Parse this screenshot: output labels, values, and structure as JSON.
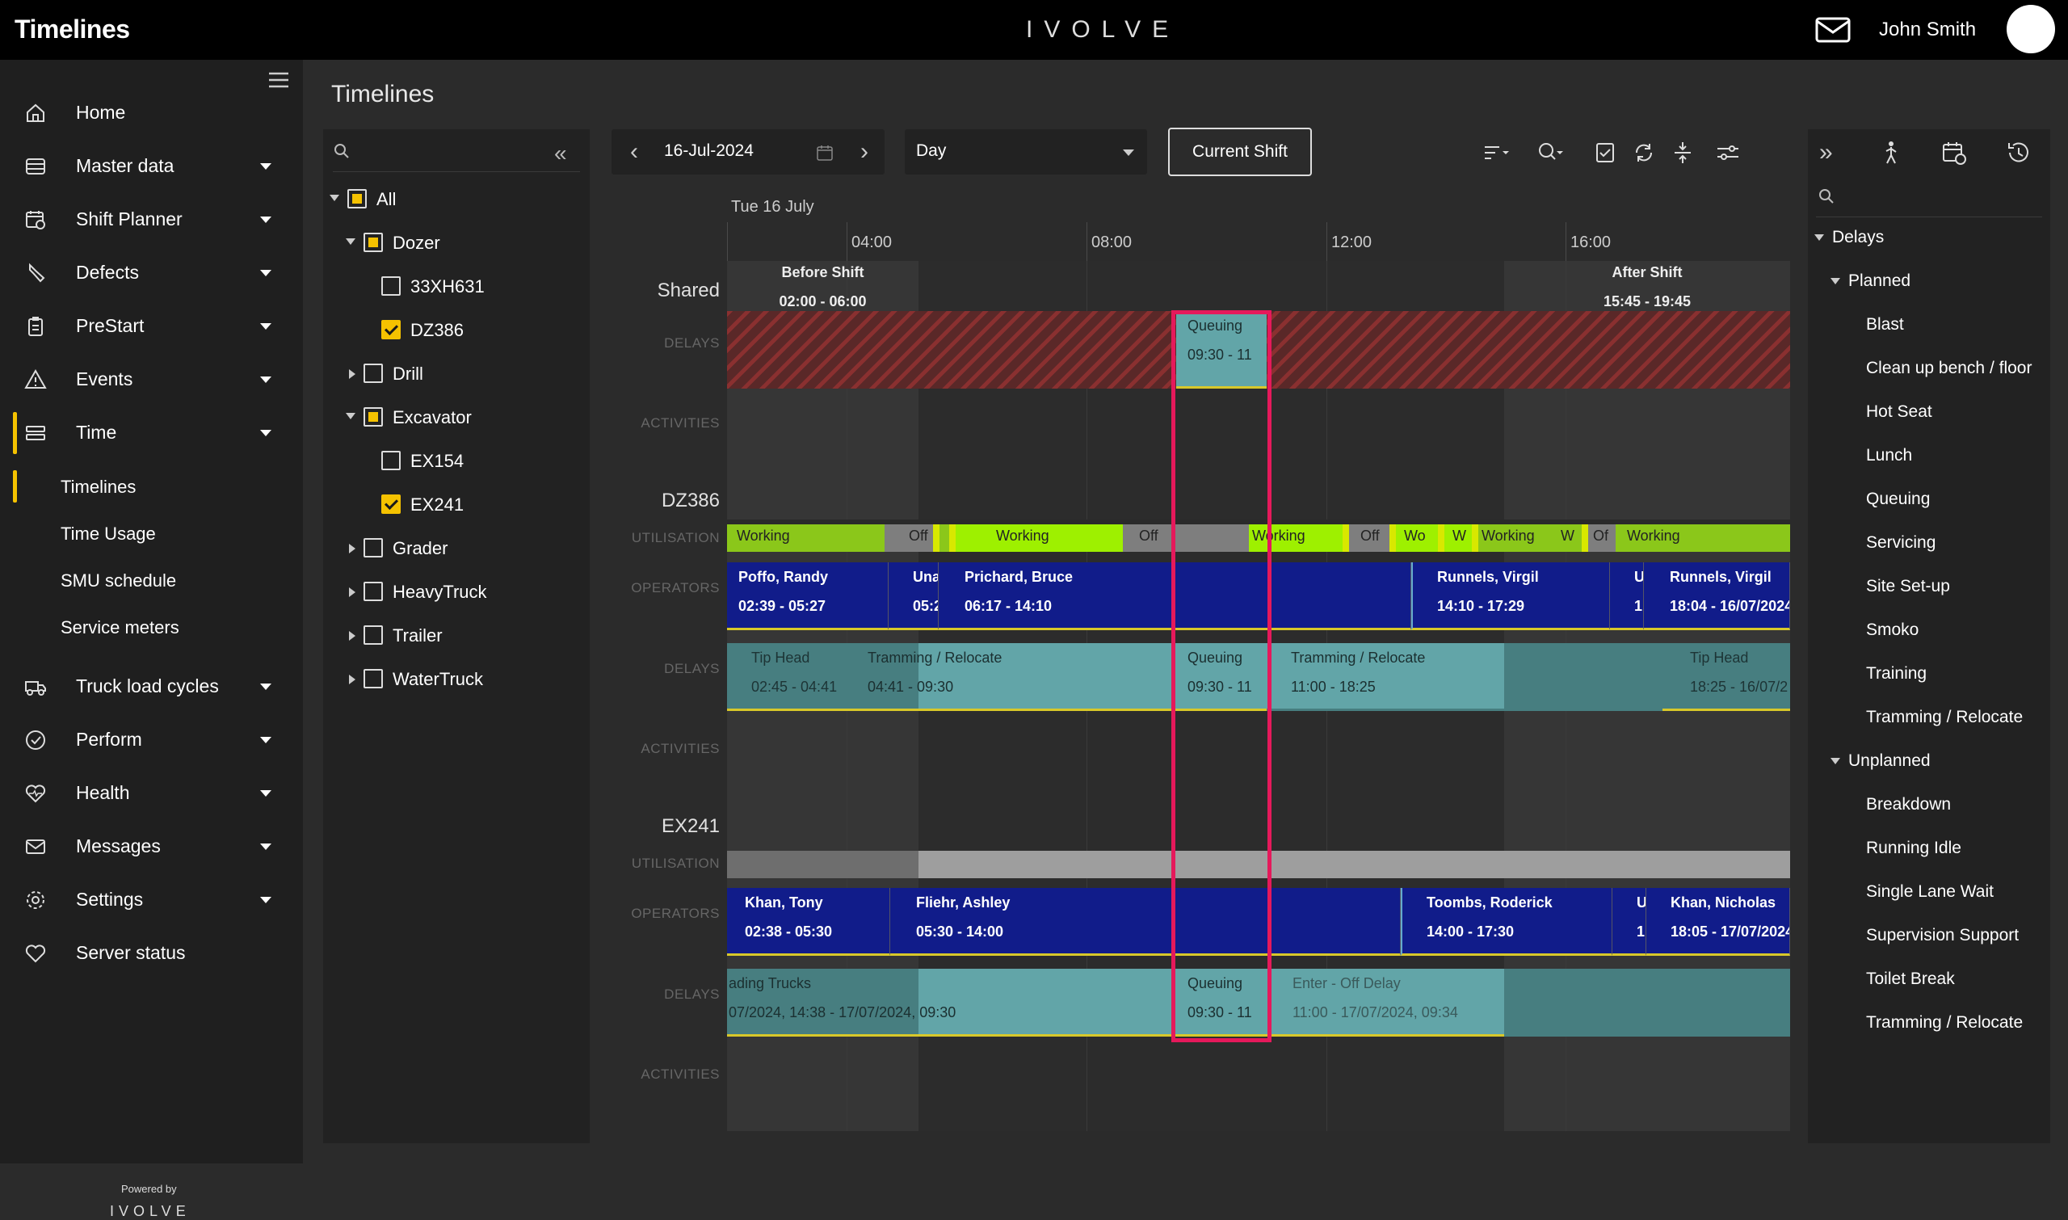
{
  "header": {
    "app_title": "Timelines",
    "brand": "IVOLVE",
    "user_name": "John Smith"
  },
  "sidebar": {
    "items": [
      {
        "label": "Home",
        "icon": "home-icon",
        "has_submenu": false
      },
      {
        "label": "Master data",
        "icon": "database-icon",
        "has_submenu": true
      },
      {
        "label": "Shift Planner",
        "icon": "calendar-icon",
        "has_submenu": true
      },
      {
        "label": "Defects",
        "icon": "wrench-icon",
        "has_submenu": true
      },
      {
        "label": "PreStart",
        "icon": "clipboard-icon",
        "has_submenu": true
      },
      {
        "label": "Events",
        "icon": "warning-icon",
        "has_submenu": true
      },
      {
        "label": "Time",
        "icon": "time-icon",
        "has_submenu": true
      }
    ],
    "time_subitems": [
      "Timelines",
      "Time Usage",
      "SMU schedule",
      "Service meters"
    ],
    "items_after": [
      {
        "label": "Truck load cycles",
        "icon": "truck-icon",
        "has_submenu": true
      },
      {
        "label": "Perform",
        "icon": "check-circle-icon",
        "has_submenu": true
      },
      {
        "label": "Health",
        "icon": "heart-pulse-icon",
        "has_submenu": true
      },
      {
        "label": "Messages",
        "icon": "mail-icon",
        "has_submenu": true
      },
      {
        "label": "Settings",
        "icon": "gear-icon",
        "has_submenu": true
      },
      {
        "label": "Server status",
        "icon": "heartbeat-icon",
        "has_submenu": false
      }
    ],
    "powered_by": "Powered by",
    "powered_brand": "IVOLVE"
  },
  "page_title": "Timelines",
  "tree": {
    "search_placeholder": "",
    "nodes": [
      {
        "label": "All",
        "level": 0,
        "expanded": true,
        "check": "partial"
      },
      {
        "label": "Dozer",
        "level": 1,
        "expanded": true,
        "check": "partial"
      },
      {
        "label": "33XH631",
        "level": 2,
        "check": "none"
      },
      {
        "label": "DZ386",
        "level": 2,
        "check": "checked"
      },
      {
        "label": "Drill",
        "level": 1,
        "expanded": false,
        "check": "none"
      },
      {
        "label": "Excavator",
        "level": 1,
        "expanded": true,
        "check": "partial"
      },
      {
        "label": "EX154",
        "level": 2,
        "check": "none"
      },
      {
        "label": "EX241",
        "level": 2,
        "check": "checked"
      },
      {
        "label": "Grader",
        "level": 1,
        "expanded": false,
        "check": "none"
      },
      {
        "label": "HeavyTruck",
        "level": 1,
        "expanded": false,
        "check": "none"
      },
      {
        "label": "Trailer",
        "level": 1,
        "expanded": false,
        "check": "none"
      },
      {
        "label": "WaterTruck",
        "level": 1,
        "expanded": false,
        "check": "none"
      }
    ]
  },
  "controls": {
    "date": "16-Jul-2024",
    "view": "Day",
    "current_shift_label": "Current Shift"
  },
  "timeline": {
    "date_header": "Tue 16 July",
    "ticks": [
      "04:00",
      "08:00",
      "12:00",
      "16:00"
    ],
    "before_shift": {
      "title": "Before Shift",
      "range": "02:00 - 06:00"
    },
    "after_shift": {
      "title": "After Shift",
      "range": "15:45 - 19:45"
    },
    "row_labels": {
      "delays": "DELAYS",
      "activities": "ACTIVITIES",
      "utilisation": "UTILISATION",
      "operators": "OPERATORS"
    },
    "sections": [
      "Shared",
      "DZ386",
      "EX241"
    ],
    "shared_delay": {
      "label": "Queuing",
      "range": "09:30 - 11"
    },
    "dz386_util": [
      "Working",
      "Off",
      "Working",
      "Off",
      "Working",
      "Off",
      "Wo",
      "W",
      "Working",
      "W",
      "Of",
      "Working"
    ],
    "dz386_ops": [
      {
        "name": "Poffo, Randy",
        "range": "02:39 - 05:27"
      },
      {
        "name": "Una",
        "range": "05:2"
      },
      {
        "name": "Prichard, Bruce",
        "range": "06:17 - 14:10"
      },
      {
        "name": "Runnels, Virgil",
        "range": "14:10 - 17:29"
      },
      {
        "name": "U",
        "range": "1"
      },
      {
        "name": "Runnels, Virgil",
        "range": "18:04 - 16/07/2024"
      }
    ],
    "dz386_delays": [
      {
        "name": "Tip Head",
        "range": "02:45 - 04:41"
      },
      {
        "name": "Tramming / Relocate",
        "range": "04:41 - 09:30"
      },
      {
        "name": "Queuing",
        "range": "09:30 - 11"
      },
      {
        "name": "Tramming / Relocate",
        "range": "11:00 - 18:25"
      },
      {
        "name": "Tip Head",
        "range": "18:25 - 16/07/2"
      }
    ],
    "ex241_ops": [
      {
        "name": "Khan, Tony",
        "range": "02:38 - 05:30"
      },
      {
        "name": "Fliehr, Ashley",
        "range": "05:30 - 14:00"
      },
      {
        "name": "Toombs, Roderick",
        "range": "14:00 - 17:30"
      },
      {
        "name": "U",
        "range": "1"
      },
      {
        "name": "Khan, Nicholas",
        "range": "18:05 - 17/07/2024"
      }
    ],
    "ex241_delays": [
      {
        "name": "ading Trucks",
        "range": "07/2024, 14:38 - 17/07/2024, 09:30"
      },
      {
        "name": "Queuing",
        "range": "09:30 - 11"
      },
      {
        "name": "Enter - Off Delay",
        "range": "11:00 - 17/07/2024, 09:34"
      }
    ]
  },
  "right_panel": {
    "search_placeholder": "",
    "root": "Delays",
    "planned_label": "Planned",
    "planned": [
      "Blast",
      "Clean up bench / floor",
      "Hot Seat",
      "Lunch",
      "Queuing",
      "Servicing",
      "Site Set-up",
      "Smoko",
      "Training",
      "Tramming / Relocate"
    ],
    "unplanned_label": "Unplanned",
    "unplanned": [
      "Breakdown",
      "Running Idle",
      "Single Lane Wait",
      "Supervision Support",
      "Toilet Break",
      "Tramming / Relocate"
    ]
  },
  "colors": {
    "accent": "#f5c200",
    "operator": "#111c8a",
    "delay": "#62a5a8",
    "working": "#8bc71a",
    "highlight": "#e5195b"
  }
}
